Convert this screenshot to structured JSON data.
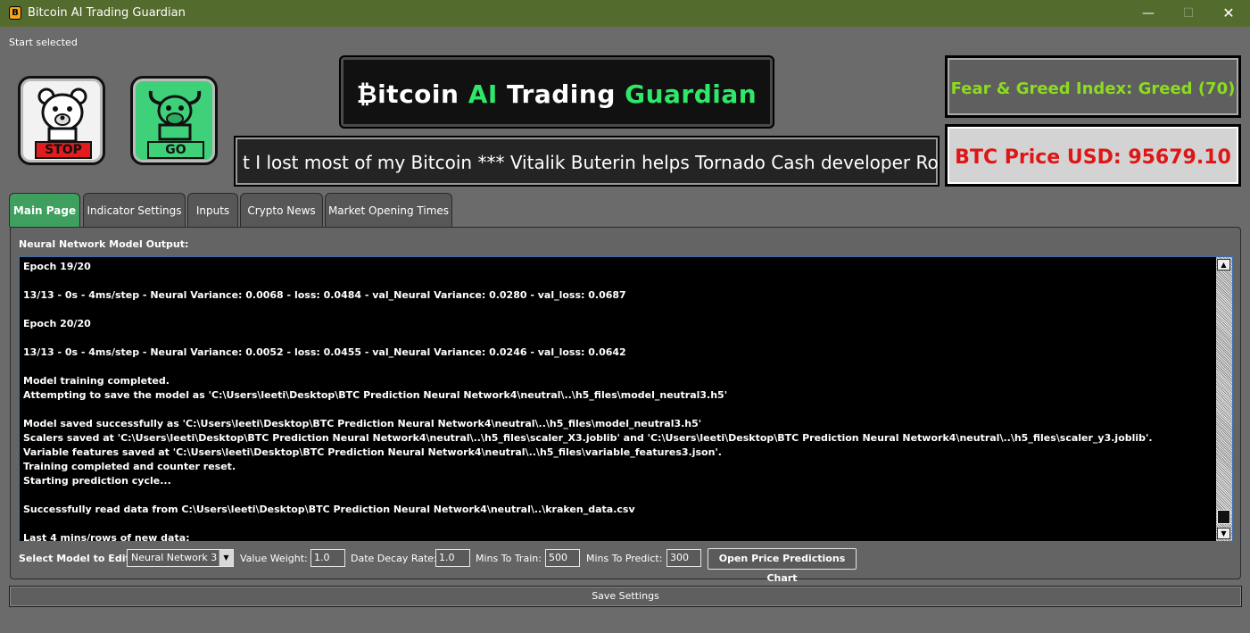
{
  "window": {
    "title": "Bitcoin AI Trading Guardian",
    "icon_glyph": "B",
    "minimize_glyph": "—",
    "maximize_glyph": "☐",
    "close_glyph": "✕"
  },
  "status_text": "Start selected",
  "controls": {
    "stop_label": "STOP",
    "go_label": "GO"
  },
  "logo": {
    "part1": "₿itcoin ",
    "part2": "AI",
    "part3": " Trading ",
    "part4": "Guardian"
  },
  "ticker": {
    "text": "t I lost most of my Bitcoin *** Vitalik Buterin helps Tornado Cash developer Roma"
  },
  "fear_greed": {
    "text": "Fear & Greed Index: Greed (70)"
  },
  "price": {
    "text": "BTC Price USD: 95679.10"
  },
  "tabs": [
    {
      "label": "Main Page"
    },
    {
      "label": "Indicator Settings"
    },
    {
      "label": "Inputs"
    },
    {
      "label": "Crypto News"
    },
    {
      "label": "Market Opening Times"
    }
  ],
  "panel": {
    "title": "Neural Network Model Output:",
    "console_lines": [
      "Epoch 19/20",
      "",
      "13/13 - 0s - 4ms/step - Neural Variance: 0.0068 - loss: 0.0484 - val_Neural Variance: 0.0280 - val_loss: 0.0687",
      "",
      "Epoch 20/20",
      "",
      "13/13 - 0s - 4ms/step - Neural Variance: 0.0052 - loss: 0.0455 - val_Neural Variance: 0.0246 - val_loss: 0.0642",
      "",
      "Model training completed.",
      "Attempting to save the model as 'C:\\Users\\leeti\\Desktop\\BTC Prediction Neural Network4\\neutral\\..\\h5_files\\model_neutral3.h5'",
      "",
      "Model saved successfully as 'C:\\Users\\leeti\\Desktop\\BTC Prediction Neural Network4\\neutral\\..\\h5_files\\model_neutral3.h5'",
      "Scalers saved at 'C:\\Users\\leeti\\Desktop\\BTC Prediction Neural Network4\\neutral\\..\\h5_files\\scaler_X3.joblib' and 'C:\\Users\\leeti\\Desktop\\BTC Prediction Neural Network4\\neutral\\..\\h5_files\\scaler_y3.joblib'.",
      "Variable features saved at 'C:\\Users\\leeti\\Desktop\\BTC Prediction Neural Network4\\neutral\\..\\h5_files\\variable_features3.json'.",
      "Training completed and counter reset.",
      "Starting prediction cycle...",
      "",
      "Successfully read data from C:\\Users\\leeti\\Desktop\\BTC Prediction Neural Network4\\neutral\\..\\kraken_data.csv",
      "",
      "Last 4 mins/rows of new data:"
    ],
    "scroll_up_glyph": "▲",
    "scroll_down_glyph": "▼"
  },
  "settings": {
    "select_model_label": "Select Model to Edit:",
    "select_model_value": "Neural Network 3",
    "select_arrow_glyph": "▼",
    "value_weight_label": "Value Weight:",
    "value_weight_value": "1.0",
    "date_decay_label": "Date Decay Rate:",
    "date_decay_value": "1.0",
    "mins_train_label": "Mins To Train:",
    "mins_train_value": "500",
    "mins_predict_label": "Mins To Predict:",
    "mins_predict_value": "300",
    "open_chart_label": "Open Price Predictions Chart"
  },
  "save_settings_label": "Save Settings"
}
